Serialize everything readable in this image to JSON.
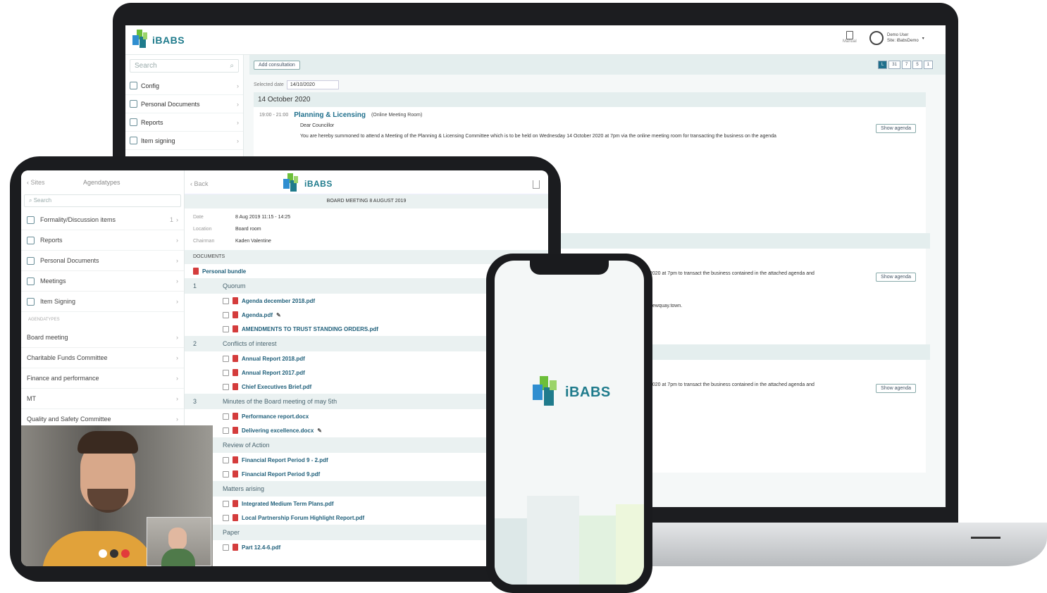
{
  "colors": {
    "brand": "#1f7b8c",
    "accent_green": "#6cbf3a",
    "accent_blue": "#2f8ed0",
    "pdf_red": "#d43c3c"
  },
  "laptop": {
    "brand": "iBABS",
    "search_placeholder": "Search",
    "manual_label": "Manual",
    "user_name": "Demo User",
    "user_site": "Site: iBabsDemo",
    "sidebar": [
      {
        "label": "Config",
        "icon": "gear-icon"
      },
      {
        "label": "Personal Documents",
        "icon": "folder-icon"
      },
      {
        "label": "Reports",
        "icon": "report-icon"
      },
      {
        "label": "Item signing",
        "icon": "signing-icon"
      }
    ],
    "add_button": "Add consultation",
    "view_buttons": [
      "L",
      "31",
      "7",
      "5",
      "1"
    ],
    "selected_date_label": "Selected date",
    "selected_date_value": "14/10/2020",
    "day_header": "14 October 2020",
    "meeting": {
      "time": "19:00 - 21:00",
      "title": "Planning & Licensing",
      "room": "(Online Meeting Room)",
      "salutation": "Dear Councillor",
      "text": "You are hereby summoned to attend a Meeting of the Planning & Licensing Committee which is to be held on Wednesday 14 October 2020 at 7pm via the online meeting room for transacting the business on the agenda"
    },
    "show_agenda": "Show agenda",
    "partial_lines": [
      "2020 at 7pm to transact the business contained in the attached agenda and",
      "newquay.town.",
      "2020 at 7pm to transact the business contained in the attached agenda and"
    ]
  },
  "tablet": {
    "back_sites": "Sites",
    "left_title": "Agendatypes",
    "search_placeholder": "Search",
    "left_items": [
      {
        "label": "Formality/Discussion items",
        "badge": "1",
        "icon": "chat-icon"
      },
      {
        "label": "Reports",
        "badge": "",
        "icon": "folder-icon"
      },
      {
        "label": "Personal Documents",
        "badge": "",
        "icon": "folder-icon"
      },
      {
        "label": "Meetings",
        "badge": "",
        "icon": "people-icon"
      },
      {
        "label": "Item Signing",
        "badge": "",
        "icon": "signing-icon"
      }
    ],
    "agendatypes_header": "AGENDATYPES",
    "agendatypes": [
      "Board meeting",
      "Charitable Funds Committee",
      "Finance and performance",
      "MT",
      "Quality and Safety Committee"
    ],
    "back": "Back",
    "brand": "iBABS",
    "meeting_title": "BOARD MEETING 8 AUGUST 2019",
    "meta": [
      {
        "k": "Date",
        "v": "8 Aug 2019 11:15 - 14:25"
      },
      {
        "k": "Location",
        "v": "Board room"
      },
      {
        "k": "Chairman",
        "v": "Kaden Valentine"
      }
    ],
    "documents_header": "DOCUMENTS",
    "personal_bundle": "Personal bundle",
    "sections": [
      {
        "num": "1",
        "title": "Quorum",
        "docs": [
          {
            "name": "Agenda december 2018.pdf",
            "pen": false
          },
          {
            "name": "Agenda.pdf",
            "pen": true
          },
          {
            "name": "AMENDMENTS TO TRUST STANDING ORDERS.pdf",
            "pen": false
          }
        ]
      },
      {
        "num": "2",
        "title": "Conflicts of interest",
        "docs": [
          {
            "name": "Annual Report 2018.pdf",
            "pen": false
          },
          {
            "name": "Annual Report 2017.pdf",
            "pen": false
          },
          {
            "name": "Chief Executives Brief.pdf",
            "pen": false
          }
        ]
      },
      {
        "num": "3",
        "title": "Minutes of the Board meeting of may 5th",
        "docs": [
          {
            "name": "Performance report.docx",
            "pen": false
          },
          {
            "name": "Delivering excellence.docx",
            "pen": true
          }
        ]
      },
      {
        "num": "",
        "title": "Review of Action",
        "docs": [
          {
            "name": "Financial Report Period 9 - 2.pdf",
            "pen": false
          },
          {
            "name": "Financial Report Period 9.pdf",
            "pen": false
          }
        ]
      },
      {
        "num": "",
        "title": "Matters arising",
        "docs": [
          {
            "name": "Integrated Medium Term Plans.pdf",
            "pen": false
          },
          {
            "name": "Local Partnership Forum Highlight Report.pdf",
            "pen": false
          }
        ]
      },
      {
        "num": "",
        "title": "Paper",
        "docs": [
          {
            "name": "Part 12.4-6.pdf",
            "pen": false
          }
        ]
      }
    ]
  },
  "phone": {
    "brand": "iBABS"
  }
}
